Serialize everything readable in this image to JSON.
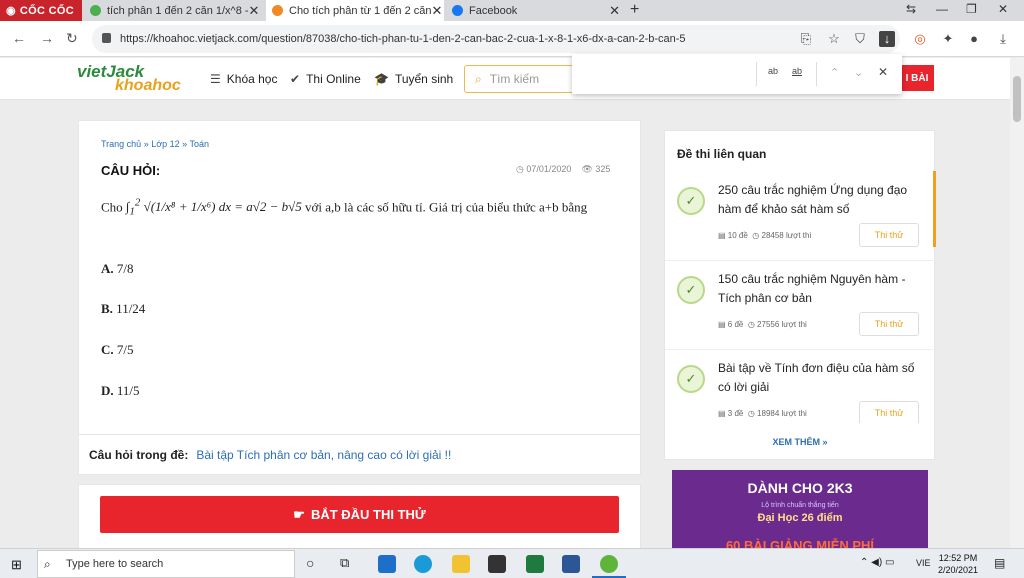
{
  "browser": {
    "brand": "CỐC CỐC",
    "tabs": [
      {
        "title": "tích phân 1 đến 2 căn 1/x^8 -",
        "color": "#4caf50"
      },
      {
        "title": "Cho tích phân từ 1 đến 2 căn",
        "color": "#f08a24"
      },
      {
        "title": "Facebook",
        "color": "#1877f2"
      }
    ],
    "url": "https://khoahoc.vietjack.com/question/87038/cho-tich-phan-tu-1-den-2-can-bac-2-cua-1-x-8-1-x6-dx-a-can-2-b-can-5"
  },
  "site": {
    "logo_top": "vietJack",
    "logo_bottom": "khoahoc",
    "nav": [
      "Khóa học",
      "Thi Online",
      "Tuyển sinh"
    ],
    "search_placeholder": "Tìm kiếm",
    "red_button": "I BÀI"
  },
  "findbar": {
    "opt1": "ab",
    "opt2": "ab"
  },
  "question": {
    "breadcrumb": [
      "Trang chủ",
      "Lớp 12",
      "Toán"
    ],
    "heading": "CÂU HỎI:",
    "date": "07/01/2020",
    "views": "325",
    "text_tail": "với a,b là các số hữu tỉ. Giá trị của biểu thức a+b bằng",
    "answers": [
      {
        "key": "A.",
        "val": "7/8"
      },
      {
        "key": "B.",
        "val": "11/24"
      },
      {
        "key": "C.",
        "val": "7/5"
      },
      {
        "key": "D.",
        "val": "11/5"
      }
    ],
    "footer_label": "Câu hỏi trong đề:",
    "footer_link": "Bài tập Tích phân cơ bản, nâng cao có lời giải !!",
    "start_button": "BẮT ĐẦU THI THỬ"
  },
  "sidebar": {
    "title": "Đề thi liên quan",
    "items": [
      {
        "title": "250 câu trắc nghiệm Ứng dụng đạo hàm để khảo sát hàm số",
        "count": "10 đề",
        "views": "28458 lượt thi",
        "button": "Thi thử"
      },
      {
        "title": "150 câu trắc nghiệm Nguyên hàm - Tích phân cơ bản",
        "count": "6 đề",
        "views": "27556 lượt thi",
        "button": "Thi thử"
      },
      {
        "title": "Bài tập về Tính đơn điệu của hàm số có lời giải",
        "count": "3 đề",
        "views": "18984 lượt thi",
        "button": "Thi thử"
      }
    ],
    "more": "XEM THÊM »"
  },
  "banner": {
    "line1": "DÀNH CHO 2K3",
    "line2": "Lộ trình chuẩn thắng tiến",
    "line3": "Đại Học 26 điểm",
    "line4": "60 BÀI GIẢNG MIỄN PHÍ"
  },
  "taskbar": {
    "search": "Type here to search",
    "lang": "VIE",
    "time": "12:52 PM",
    "date": "2/20/2021"
  }
}
